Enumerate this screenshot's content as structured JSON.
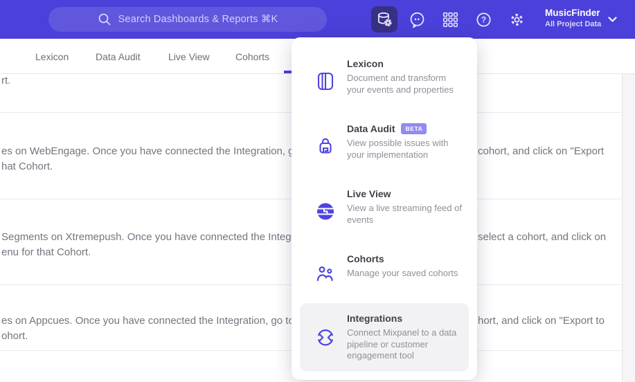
{
  "header": {
    "search_placeholder": "Search Dashboards & Reports ⌘K",
    "project_name": "MusicFinder",
    "project_scope": "All Project Data"
  },
  "tabs": {
    "items": [
      "Lexicon",
      "Data Audit",
      "Live View",
      "Cohorts"
    ]
  },
  "menu": {
    "items": [
      {
        "title": "Lexicon",
        "description": "Document and transform your events and properties"
      },
      {
        "title": "Data Audit",
        "badge": "BETA",
        "description": "View possible issues with your implementation"
      },
      {
        "title": "Live View",
        "description": "View a live streaming feed of events"
      },
      {
        "title": "Cohorts",
        "description": "Manage your saved cohorts"
      },
      {
        "title": "Integrations",
        "description": "Connect Mixpanel to a data pipeline or customer engagement tool"
      }
    ]
  },
  "content": {
    "row0_fragment": "rt.",
    "rows": [
      {
        "line1_left": "es on WebEngage. Once you have connected the Integration, go to the",
        "line1_right": "cohort, and click on \"Export",
        "line2": "hat Cohort."
      },
      {
        "line1_left": "Segments on Xtremepush. Once you have connected the Integration,",
        "line1_right": "select a cohort, and click on",
        "line2": "enu for that Cohort."
      },
      {
        "line1_left": "es on Appcues. Once you have connected the Integration, go to the M",
        "line1_right": "hort, and click on \"Export to",
        "line2": "ohort."
      }
    ]
  },
  "glyphs": {
    "help": "?"
  },
  "icons": {
    "search": "magnifier",
    "data_management": "database-with-gear",
    "feedback": "chat-bubble-dots",
    "apps": "nine-square-grid",
    "help": "question-circle",
    "settings": "gear",
    "chevron": "chevron-down",
    "lexicon": "book",
    "data_audit": "spiral-lock",
    "live_view": "globe",
    "cohorts": "two-people",
    "integrations": "circular-sync-arrows"
  },
  "colors": {
    "header_bg": "#4b40d9",
    "accent": "#4f44e0",
    "active_button_bg": "#383086",
    "badge_bg": "#948af0",
    "highlight_bg": "#f2f2f4"
  }
}
